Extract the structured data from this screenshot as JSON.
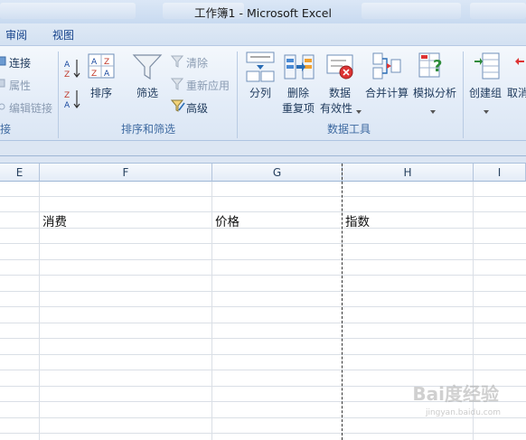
{
  "window": {
    "title": "工作簿1 - Microsoft Excel"
  },
  "tabs": [
    {
      "label": "审阅"
    },
    {
      "label": "视图"
    }
  ],
  "ribbon": {
    "connections": {
      "connect": "连接",
      "properties": "属性",
      "edit_links": "编辑链接",
      "group_label": "接"
    },
    "sort_filter": {
      "sort": "排序",
      "filter": "筛选",
      "clear": "清除",
      "reapply": "重新应用",
      "advanced": "高级",
      "group_label": "排序和筛选"
    },
    "data_tools": {
      "text_to_columns": "分列",
      "remove_dup_1": "删除",
      "remove_dup_2": "重复项",
      "validation_1": "数据",
      "validation_2": "有效性",
      "consolidate": "合并计算",
      "what_if": "模拟分析",
      "group_label": "数据工具"
    },
    "outline": {
      "group": "创建组",
      "ungroup": "取消"
    }
  },
  "columns": [
    {
      "label": "E"
    },
    {
      "label": "F"
    },
    {
      "label": "G"
    },
    {
      "label": "H"
    },
    {
      "label": "I"
    }
  ],
  "cells": {
    "f": "消费",
    "g": "价格",
    "h": "指数"
  },
  "watermark": {
    "main": "Bai度经验",
    "sub": "jingyan.baidu.com"
  },
  "colors": {
    "ribbon_text": "#1e395b",
    "group_label": "#3e6aa1",
    "dim": "#8a9bb2"
  }
}
